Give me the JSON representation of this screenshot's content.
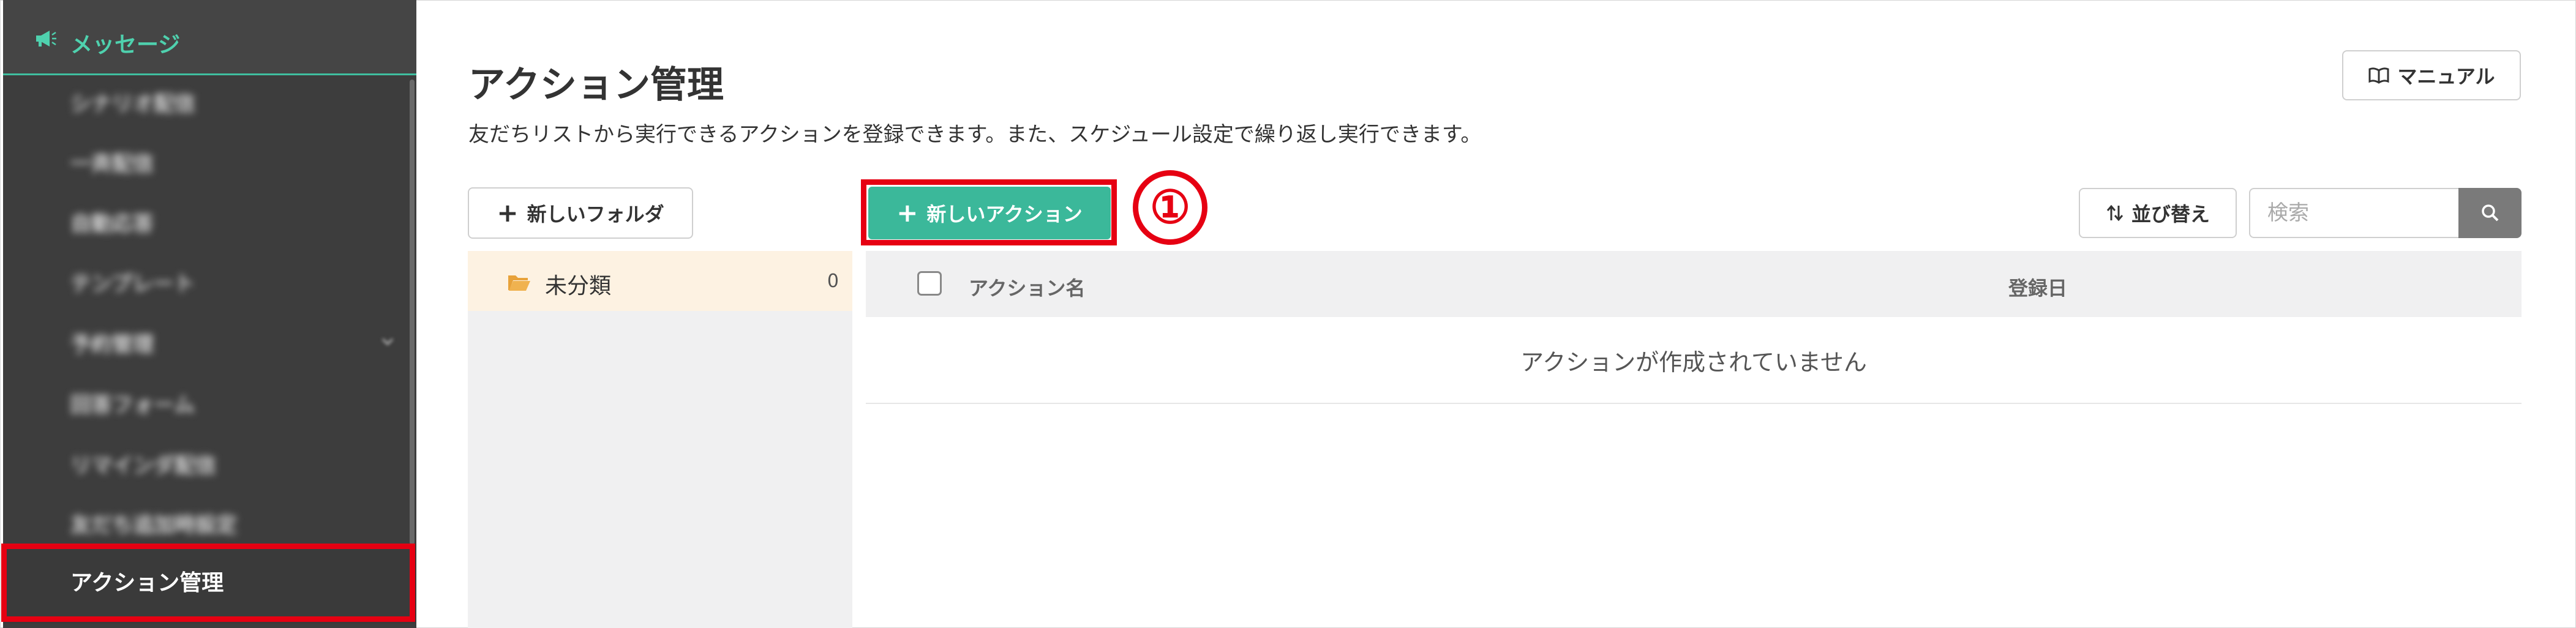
{
  "sidebar": {
    "section_icon": "megaphone-icon",
    "section_label": "メッセージ",
    "items": [
      {
        "label": "シナリオ配信"
      },
      {
        "label": "一斉配信"
      },
      {
        "label": "自動応答"
      },
      {
        "label": "テンプレート"
      },
      {
        "label": "予約管理"
      },
      {
        "label": "回答フォーム"
      },
      {
        "label": "リマインダ配信"
      },
      {
        "label": "友だち追加時設定"
      }
    ],
    "active_item": "アクション管理"
  },
  "page": {
    "title": "アクション管理",
    "description": "友だちリストから実行できるアクションを登録できます。また、スケジュール設定で繰り返し実行できます。",
    "manual_label": "マニュアル"
  },
  "toolbar": {
    "new_folder_label": "新しいフォルダ",
    "new_action_label": "新しいアクション",
    "sort_label": "並び替え",
    "search_placeholder": "検索"
  },
  "annotation": {
    "step_number": "①",
    "color": "#e60012"
  },
  "folders": [
    {
      "name": "未分類",
      "count": "0"
    }
  ],
  "table": {
    "columns": [
      "アクション名",
      "登録日"
    ],
    "empty_message": "アクションが作成されていません"
  },
  "colors": {
    "accent": "#3bb89a",
    "highlight": "#e60012",
    "sidebar": "#3d3d3d"
  }
}
